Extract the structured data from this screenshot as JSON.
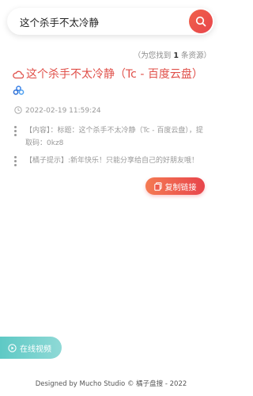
{
  "search": {
    "value": "这个杀手不太冷静",
    "placeholder": ""
  },
  "results_summary": {
    "prefix": "（为您找到",
    "count": "1",
    "suffix": "条资源）"
  },
  "result": {
    "title": "这个杀手不太冷静（Tc - 百度云盘）",
    "time": "2022-02-19 11:59:24",
    "content": "【内容】：标题：这个杀手不太冷静（Tc - 百度云盘），提取码：0kz8",
    "hint": "【橘子提示】:新年快乐！只能分享给自己的好朋友哦！"
  },
  "buttons": {
    "copy_link": "复制链接",
    "online_video": "在线视频"
  },
  "footer": "Designed by Mucho Studio © 橘子盘搜 - 2022",
  "colors": {
    "accent": "#e8454c",
    "title": "#e0504a",
    "teal": "#5ec9c5"
  }
}
